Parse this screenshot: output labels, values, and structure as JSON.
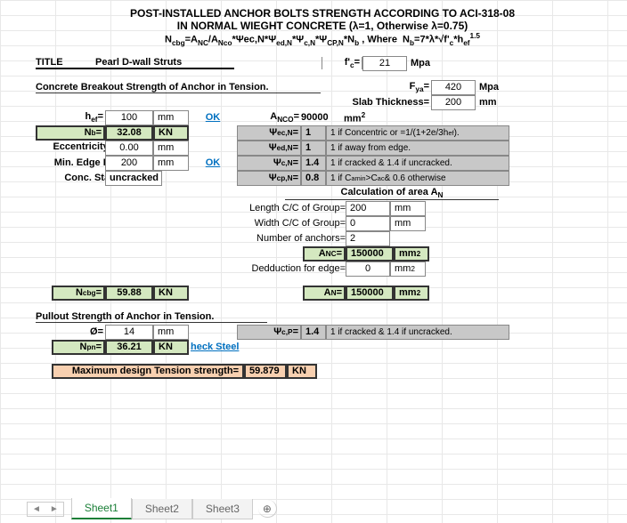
{
  "header": {
    "title1": "POST-INSTALLED ANCHOR BOLTS STRENGTH ACCORDING TO ACI-318-08",
    "title2": "IN NORMAL WIEGHT CONCRETE (λ=1, Otherwise λ=0.75)",
    "formula": "N_cbg = A_NC/A_Nco * Ψec,N * Ψ_ed,N * Ψ_c,N * Ψ_CP,N * N_b ,  Where  N_b = 7*λ*√f'c*h_ef^1.5"
  },
  "title_row": {
    "label": "TITLE",
    "value": "Pearl D-wall Struts"
  },
  "fc": {
    "label": "f'c=",
    "value": "21",
    "unit": "Mpa"
  },
  "section1": "Concrete Breakout Strength of Anchor in Tension.",
  "fya": {
    "label": "F_ya=",
    "value": "420",
    "unit": "Mpa"
  },
  "slab": {
    "label": "Slab Thickness=",
    "value": "200",
    "unit": "mm"
  },
  "hef": {
    "label": "h_ef=",
    "value": "100",
    "unit": "mm",
    "ok": "OK"
  },
  "anco": {
    "label": "A_NCO=",
    "value": "90000",
    "unit": "mm²"
  },
  "nb": {
    "label": "N_b=",
    "value": "32.08",
    "unit": "KN"
  },
  "psi_ec": {
    "label": "Ψ_ec,N=",
    "value": "1",
    "note": "1 if Concentric or =1/(1+2e/3h_ef)."
  },
  "ecc": {
    "label": "Eccentricity e'_N=",
    "value": "0.00",
    "unit": "mm"
  },
  "psi_ed": {
    "label": "Ψ_ed,N=",
    "value": "1",
    "note": "1 if away from edge."
  },
  "minedge": {
    "label": "Min. Edge Dist.=",
    "value": "200",
    "unit": "mm",
    "ok": "OK"
  },
  "psi_c": {
    "label": "Ψ_c,N=",
    "value": "1.4",
    "note": "1 if cracked & 1.4 if uncracked."
  },
  "conc": {
    "label": "Conc. Status=",
    "value": "uncracked"
  },
  "psi_cp": {
    "label": "Ψ_cp,N=",
    "value": "0.8",
    "note": "1 if C_amin > C_ac & 0.6 otherwise"
  },
  "area_calc": {
    "title": "Calculation of area A_N",
    "len": {
      "label": "Length C/C of Group=",
      "value": "200",
      "unit": "mm"
    },
    "wid": {
      "label": "Width C/C of Group=",
      "value": "0",
      "unit": "mm"
    },
    "num": {
      "label": "Number of anchors=",
      "value": "2"
    },
    "anc": {
      "label": "A_NC=",
      "value": "150000",
      "unit": "mm²"
    },
    "ded": {
      "label": "Dedduction for edge=",
      "value": "0",
      "unit": "mm²"
    }
  },
  "ncbg": {
    "label": "N_cbg=",
    "value": "59.88",
    "unit": "KN"
  },
  "an": {
    "label": "A_N=",
    "value": "150000",
    "unit": "mm²"
  },
  "section2": "Pullout Strength of Anchor in Tension.",
  "dia": {
    "label": "Ø=",
    "value": "14",
    "unit": "mm"
  },
  "psi_cp2": {
    "label": "Ψ_c,P=",
    "value": "1.4",
    "note": "1 if cracked & 1.4 if uncracked."
  },
  "npn": {
    "label": "N_pn=",
    "value": "36.21",
    "unit": "KN",
    "link": "heck Steel"
  },
  "max": {
    "label": "Maximum design Tension strength=",
    "value": "59.879",
    "unit": "KN"
  },
  "tabs": [
    "Sheet1",
    "Sheet2",
    "Sheet3"
  ]
}
